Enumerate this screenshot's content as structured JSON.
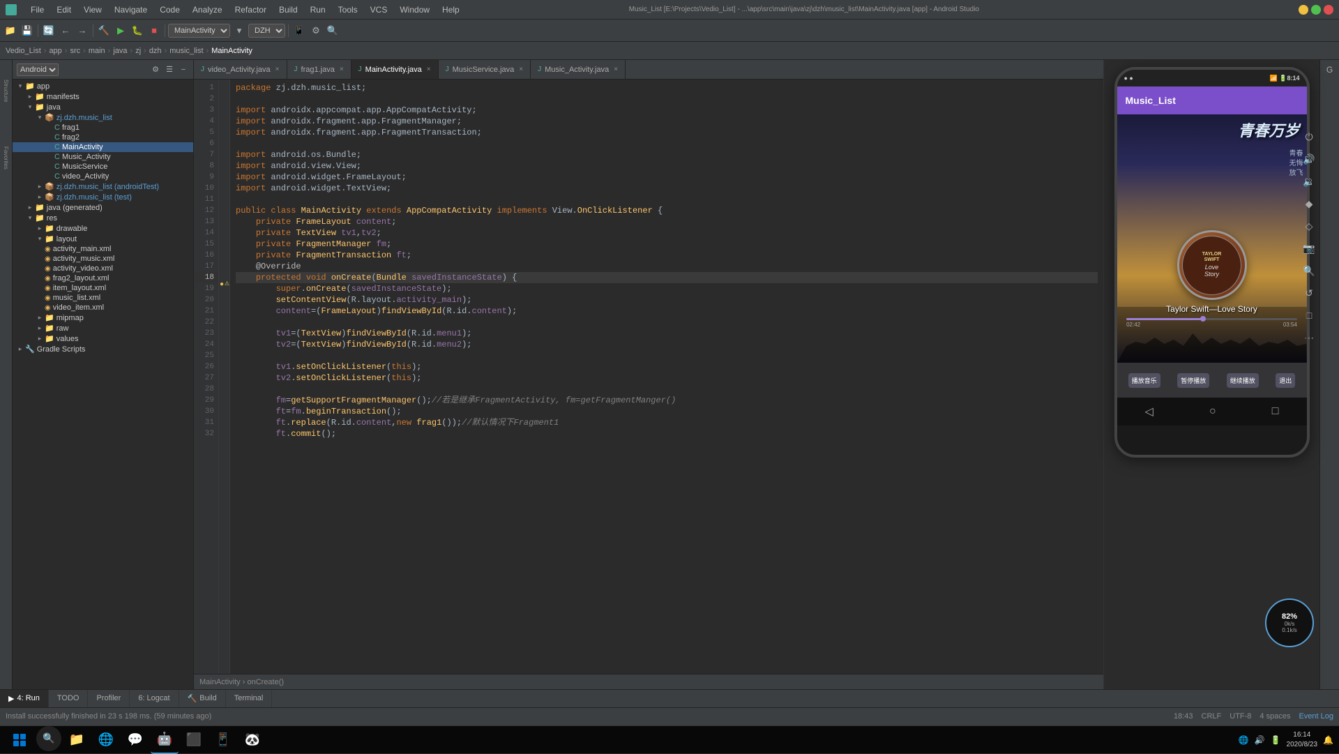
{
  "titlebar": {
    "title": "Music_List [E:\\Projects\\Vedio_List] - ...\\app\\src\\main\\java\\zj\\dzh\\music_list\\MainActivity.java [app] - Android Studio",
    "menus": [
      "File",
      "Edit",
      "View",
      "Navigate",
      "Code",
      "Analyze",
      "Refactor",
      "Build",
      "Run",
      "Tools",
      "VCS",
      "Window",
      "Help"
    ]
  },
  "toolbar": {
    "dropdown1": "MainActivity",
    "dropdown2": "DZH"
  },
  "breadcrumb": {
    "items": [
      "Vedio_List",
      "app",
      "src",
      "main",
      "java",
      "zj",
      "dzh",
      "music_list",
      "MainActivity"
    ]
  },
  "project": {
    "header": "Android",
    "tree": [
      {
        "indent": 0,
        "type": "folder",
        "label": "app",
        "expanded": true
      },
      {
        "indent": 1,
        "type": "folder",
        "label": "manifests",
        "expanded": false
      },
      {
        "indent": 1,
        "type": "folder",
        "label": "java",
        "expanded": true
      },
      {
        "indent": 2,
        "type": "package",
        "label": "zj.dzh.music_list",
        "expanded": true,
        "highlight": true
      },
      {
        "indent": 3,
        "type": "class",
        "label": "frag1"
      },
      {
        "indent": 3,
        "type": "class",
        "label": "frag2"
      },
      {
        "indent": 3,
        "type": "class",
        "label": "MainActivity",
        "selected": true
      },
      {
        "indent": 3,
        "type": "class",
        "label": "Music_Activity"
      },
      {
        "indent": 3,
        "type": "class",
        "label": "MusicService"
      },
      {
        "indent": 3,
        "type": "class",
        "label": "video_Activity"
      },
      {
        "indent": 2,
        "type": "package",
        "label": "zj.dzh.music_list (androidTest)",
        "expanded": false
      },
      {
        "indent": 2,
        "type": "package",
        "label": "zj.dzh.music_list (test)",
        "expanded": false
      },
      {
        "indent": 1,
        "type": "folder",
        "label": "java (generated)",
        "expanded": false
      },
      {
        "indent": 1,
        "type": "folder",
        "label": "res",
        "expanded": true
      },
      {
        "indent": 2,
        "type": "folder",
        "label": "drawable",
        "expanded": false
      },
      {
        "indent": 2,
        "type": "folder",
        "label": "layout",
        "expanded": true
      },
      {
        "indent": 3,
        "type": "file",
        "label": "activity_main.xml"
      },
      {
        "indent": 3,
        "type": "file",
        "label": "activity_music.xml"
      },
      {
        "indent": 3,
        "type": "file",
        "label": "activity_video.xml"
      },
      {
        "indent": 3,
        "type": "file",
        "label": "frag2_layout.xml"
      },
      {
        "indent": 3,
        "type": "file",
        "label": "item_layout.xml"
      },
      {
        "indent": 3,
        "type": "file",
        "label": "music_list.xml"
      },
      {
        "indent": 3,
        "type": "file",
        "label": "video_item.xml"
      },
      {
        "indent": 2,
        "type": "folder",
        "label": "mipmap",
        "expanded": false
      },
      {
        "indent": 2,
        "type": "folder",
        "label": "raw",
        "expanded": false
      },
      {
        "indent": 2,
        "type": "folder",
        "label": "values",
        "expanded": false
      },
      {
        "indent": 0,
        "type": "folder",
        "label": "Gradle Scripts",
        "expanded": false
      }
    ]
  },
  "tabs": [
    {
      "label": "video_Activity.java",
      "active": false
    },
    {
      "label": "frag1.java",
      "active": false
    },
    {
      "label": "MainActivity.java",
      "active": true
    },
    {
      "label": "MusicService.java",
      "active": false
    },
    {
      "label": "Music_Activity.java",
      "active": false
    }
  ],
  "code": {
    "lines": [
      {
        "num": 1,
        "content": "package zj.dzh.music_list;",
        "type": "plain"
      },
      {
        "num": 2,
        "content": "",
        "type": "plain"
      },
      {
        "num": 3,
        "content": "import androidx.appcompat.app.AppCompatActivity;",
        "type": "import"
      },
      {
        "num": 4,
        "content": "import androidx.fragment.app.FragmentManager;",
        "type": "import"
      },
      {
        "num": 5,
        "content": "import androidx.fragment.app.FragmentTransaction;",
        "type": "import"
      },
      {
        "num": 6,
        "content": "",
        "type": "plain"
      },
      {
        "num": 7,
        "content": "import android.os.Bundle;",
        "type": "import"
      },
      {
        "num": 8,
        "content": "import android.view.View;",
        "type": "import"
      },
      {
        "num": 9,
        "content": "import android.widget.FrameLayout;",
        "type": "import"
      },
      {
        "num": 10,
        "content": "import android.widget.TextView;",
        "type": "import"
      },
      {
        "num": 11,
        "content": "",
        "type": "plain"
      },
      {
        "num": 12,
        "content": "public class MainActivity extends AppCompatActivity implements View.OnClickListener {",
        "type": "class"
      },
      {
        "num": 13,
        "content": "    private FrameLayout content;",
        "type": "field"
      },
      {
        "num": 14,
        "content": "    private TextView tv1,tv2;",
        "type": "field"
      },
      {
        "num": 15,
        "content": "    private FragmentManager fm;",
        "type": "field"
      },
      {
        "num": 16,
        "content": "    private FragmentTransaction ft;",
        "type": "field"
      },
      {
        "num": 17,
        "content": "    @Override",
        "type": "annotation"
      },
      {
        "num": 18,
        "content": "    protected void onCreate(Bundle savedInstanceState) {",
        "type": "method",
        "highlighted": true
      },
      {
        "num": 19,
        "content": "        super.onCreate(savedInstanceState);",
        "type": "code"
      },
      {
        "num": 20,
        "content": "        setContentView(R.layout.activity_main);",
        "type": "code"
      },
      {
        "num": 21,
        "content": "        content=(FrameLayout)findViewById(R.id.content);",
        "type": "code"
      },
      {
        "num": 22,
        "content": "",
        "type": "plain"
      },
      {
        "num": 23,
        "content": "        tv1=(TextView)findViewById(R.id.menu1);",
        "type": "code"
      },
      {
        "num": 24,
        "content": "        tv2=(TextView)findViewById(R.id.menu2);",
        "type": "code"
      },
      {
        "num": 25,
        "content": "",
        "type": "plain"
      },
      {
        "num": 26,
        "content": "        tv1.setOnClickListener(this);",
        "type": "code"
      },
      {
        "num": 27,
        "content": "        tv2.setOnClickListener(this);",
        "type": "code"
      },
      {
        "num": 28,
        "content": "",
        "type": "plain"
      },
      {
        "num": 29,
        "content": "        fm=getSupportFragmentManager();//若是继承FragmentActivity, fm=getFragmentManger()",
        "type": "code"
      },
      {
        "num": 30,
        "content": "        ft=fm.beginTransaction();",
        "type": "code"
      },
      {
        "num": 31,
        "content": "        ft.replace(R.id.content,new frag1());//默认情况下Fragment1",
        "type": "code"
      },
      {
        "num": 32,
        "content": "        ft.commit();",
        "type": "code"
      }
    ]
  },
  "phone": {
    "status_time": "8:14",
    "app_title": "Music_List",
    "song_title": "Taylor Swift—Love Story",
    "time_elapsed": "02:42",
    "time_total": "03:54",
    "chinese_text": "青春万岁",
    "buttons": [
      "播放音乐",
      "暂停播放",
      "继续播放",
      "退出"
    ],
    "album_lines": [
      "TAYLOR",
      "SWIFT",
      "Love",
      "Story"
    ]
  },
  "bottom_tabs": [
    {
      "label": "4: Run",
      "num": null,
      "icon": "▶"
    },
    {
      "label": "TODO",
      "num": null,
      "icon": ""
    },
    {
      "label": "Profiler",
      "num": null,
      "icon": ""
    },
    {
      "label": "6: Logcat",
      "num": null,
      "icon": ""
    },
    {
      "label": "Build",
      "num": null,
      "icon": ""
    },
    {
      "label": "Terminal",
      "num": null,
      "icon": ""
    }
  ],
  "status_bar": {
    "message": "Install successfully finished in 23 s 198 ms. (59 minutes ago)",
    "time": "18:43",
    "encoding": "CRLF",
    "charset": "UTF-8",
    "indent": "4 spaces"
  },
  "taskbar": {
    "clock_time": "16:14",
    "clock_date": "2020/8/23"
  },
  "breadcrumb_code": {
    "text": "MainActivity › onCreate()"
  }
}
